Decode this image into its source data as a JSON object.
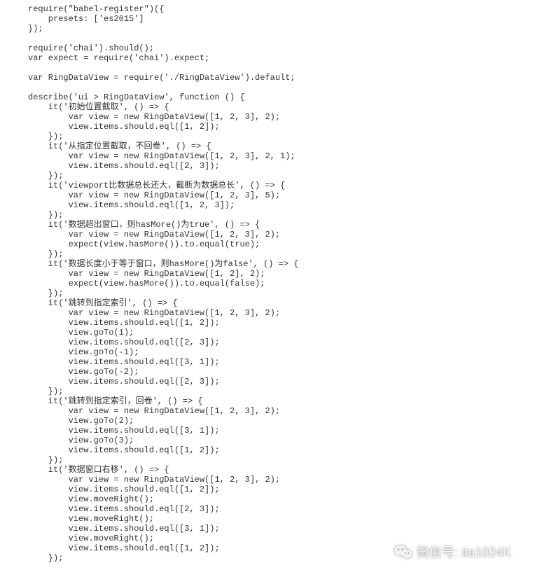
{
  "code_lines": [
    "require(\"babel-register\")({",
    "    presets: ['es2015']",
    "});",
    "",
    "require('chai').should();",
    "var expect = require('chai').expect;",
    "",
    "var RingDataView = require('./RingDataView').default;",
    "",
    "describe('ui > RingDataView', function () {",
    "    it('初始位置截取', () => {",
    "        var view = new RingDataView([1, 2, 3], 2);",
    "        view.items.should.eql([1, 2]);",
    "    });",
    "    it('从指定位置截取，不回卷', () => {",
    "        var view = new RingDataView([1, 2, 3], 2, 1);",
    "        view.items.should.eql([2, 3]);",
    "    });",
    "    it('viewport比数据总长还大，截断为数据总长', () => {",
    "        var view = new RingDataView([1, 2, 3], 5);",
    "        view.items.should.eql([1, 2, 3]);",
    "    });",
    "    it('数据超出窗口，则hasMore()为true', () => {",
    "        var view = new RingDataView([1, 2, 3], 2);",
    "        expect(view.hasMore()).to.equal(true);",
    "    });",
    "    it('数据长度小于等于窗口，则hasMore()为false', () => {",
    "        var view = new RingDataView([1, 2], 2);",
    "        expect(view.hasMore()).to.equal(false);",
    "    });",
    "    it('跳转到指定索引', () => {",
    "        var view = new RingDataView([1, 2, 3], 2);",
    "        view.items.should.eql([1, 2]);",
    "        view.goTo(1);",
    "        view.items.should.eql([2, 3]);",
    "        view.goTo(-1);",
    "        view.items.should.eql([3, 1]);",
    "        view.goTo(-2);",
    "        view.items.should.eql([2, 3]);",
    "    });",
    "    it('跳转到指定索引，回卷', () => {",
    "        var view = new RingDataView([1, 2, 3], 2);",
    "        view.goTo(2);",
    "        view.items.should.eql([3, 1]);",
    "        view.goTo(3);",
    "        view.items.should.eql([1, 2]);",
    "    });",
    "    it('数据窗口右移', () => {",
    "        var view = new RingDataView([1, 2, 3], 2);",
    "        view.items.should.eql([1, 2]);",
    "        view.moveRight();",
    "        view.items.should.eql([2, 3]);",
    "        view.moveRight();",
    "        view.items.should.eql([3, 1]);",
    "        view.moveRight();",
    "        view.items.should.eql([1, 2]);",
    "    });"
  ],
  "watermark": {
    "text": "微信号: ita1024K"
  }
}
